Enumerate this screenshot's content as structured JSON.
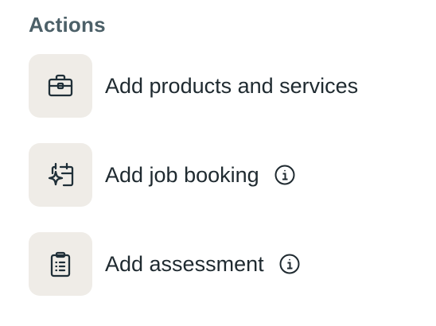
{
  "section": {
    "title": "Actions"
  },
  "actions": [
    {
      "label": "Add products and services",
      "icon": "briefcase-icon",
      "has_info": false
    },
    {
      "label": "Add job booking",
      "icon": "calendar-sparkle-icon",
      "has_info": true
    },
    {
      "label": "Add assessment",
      "icon": "clipboard-list-icon",
      "has_info": true
    }
  ],
  "colors": {
    "title": "#4c6068",
    "text": "#1f2a30",
    "tile_background": "#efece7",
    "icon_stroke": "#1f2f38"
  }
}
